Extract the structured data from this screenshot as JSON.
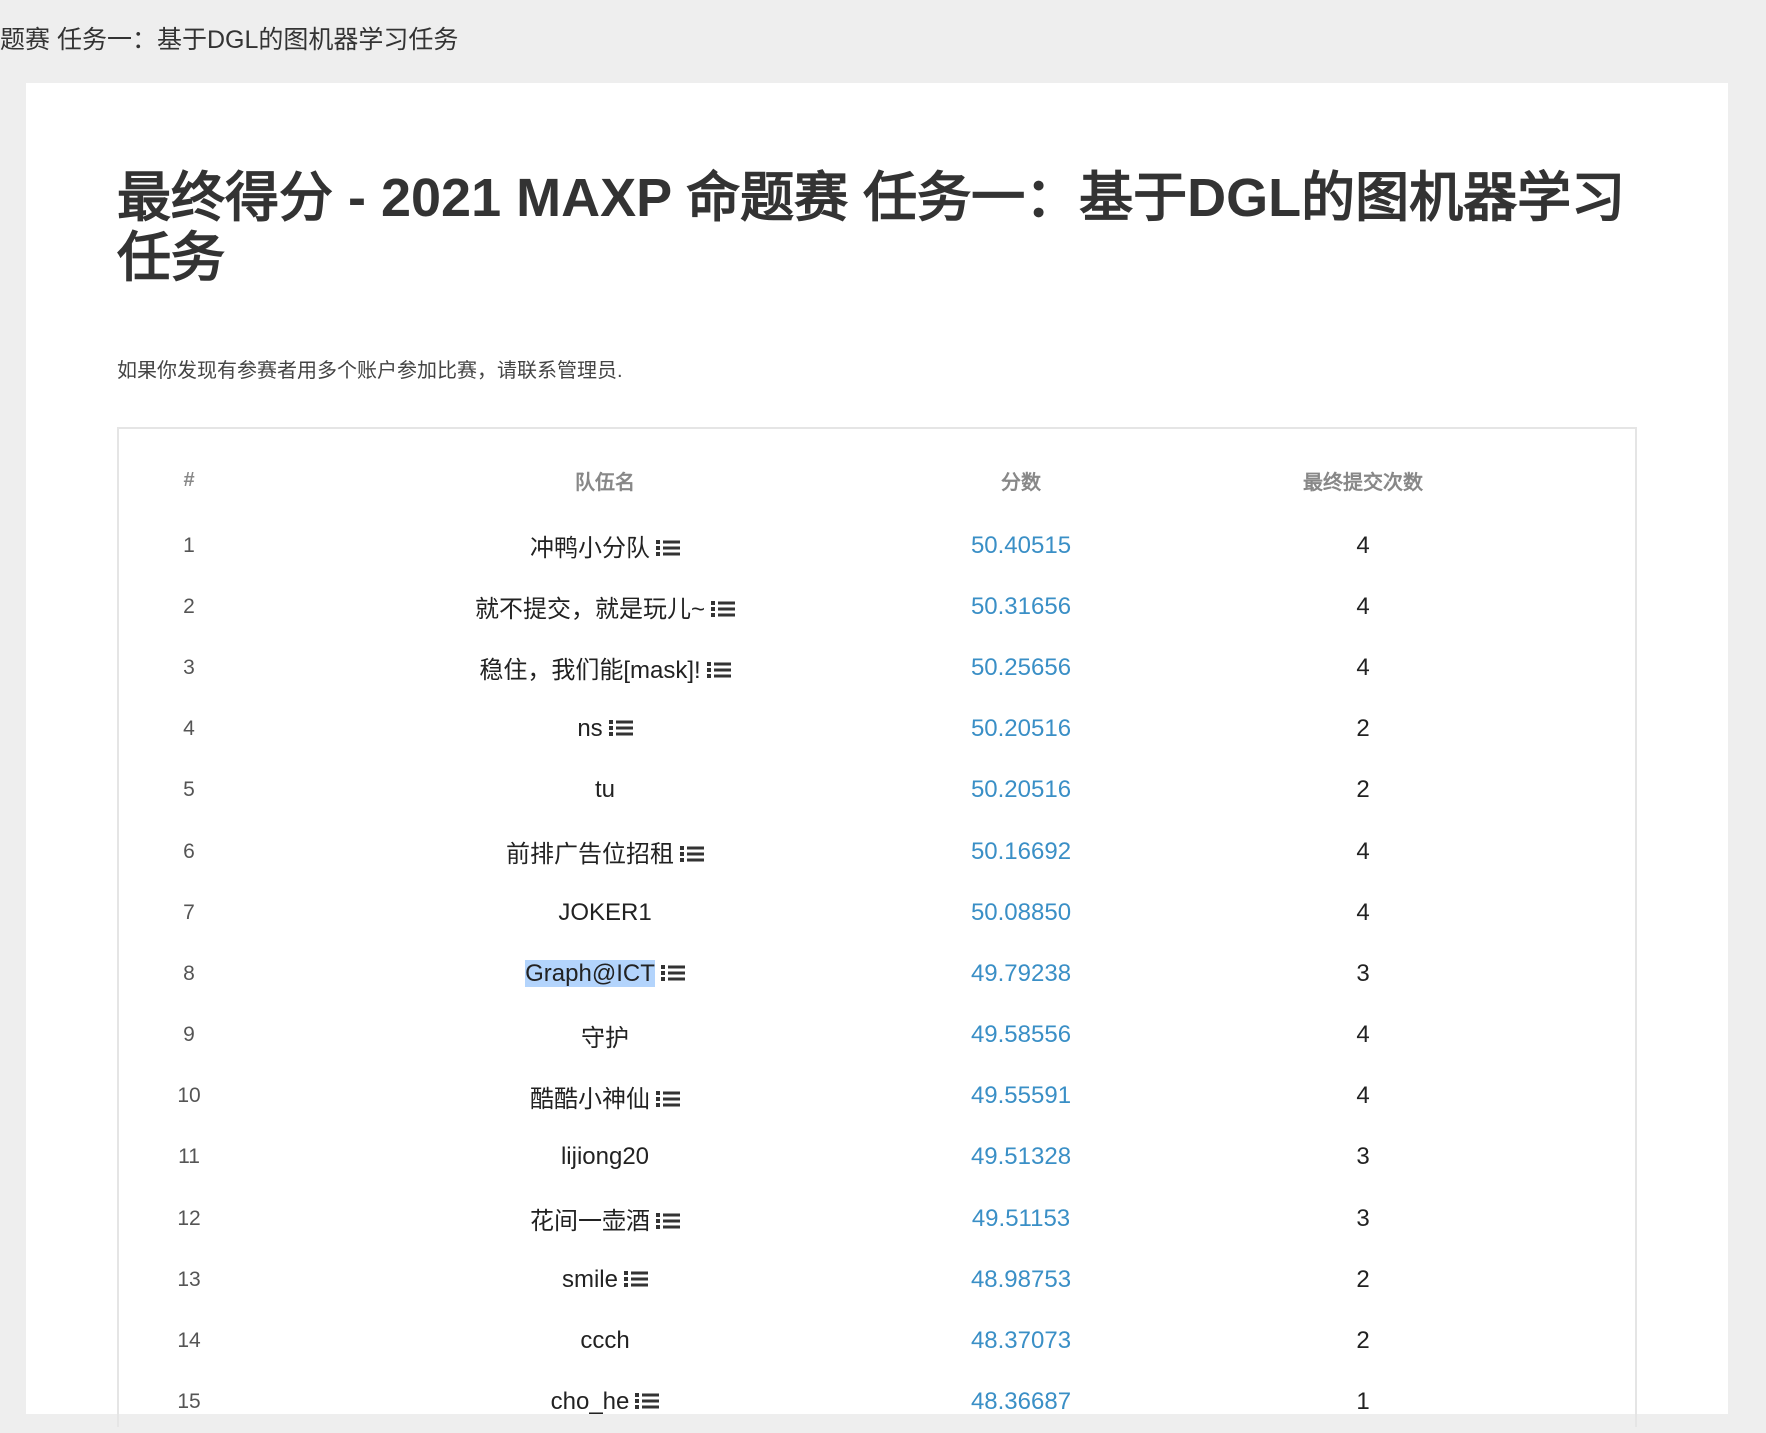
{
  "browser_tab_title": "题赛 任务一：基于DGL的图机器学习任务",
  "page_title": "最终得分 - 2021 MAXP 命题赛 任务一：基于DGL的图机器学习任务",
  "notice": "如果你发现有参赛者用多个账户参加比赛，请联系管理员.",
  "colors": {
    "score_link": "#3a8fc6",
    "selection": "#b3d4fc"
  },
  "table": {
    "headers": [
      "#",
      "队伍名",
      "分数",
      "最终提交次数"
    ],
    "rows": [
      {
        "rank": "1",
        "team": "冲鸭小分队",
        "has_list_icon": true,
        "score": "50.40515",
        "submissions": "4"
      },
      {
        "rank": "2",
        "team": "就不提交，就是玩儿~",
        "has_list_icon": true,
        "score": "50.31656",
        "submissions": "4"
      },
      {
        "rank": "3",
        "team": "稳住，我们能[mask]!",
        "has_list_icon": true,
        "score": "50.25656",
        "submissions": "4"
      },
      {
        "rank": "4",
        "team": "ns",
        "has_list_icon": true,
        "score": "50.20516",
        "submissions": "2"
      },
      {
        "rank": "5",
        "team": "tu",
        "has_list_icon": false,
        "score": "50.20516",
        "submissions": "2"
      },
      {
        "rank": "6",
        "team": "前排广告位招租",
        "has_list_icon": true,
        "score": "50.16692",
        "submissions": "4"
      },
      {
        "rank": "7",
        "team": "JOKER1",
        "has_list_icon": false,
        "score": "50.08850",
        "submissions": "4"
      },
      {
        "rank": "8",
        "team": "Graph@ICT",
        "has_list_icon": true,
        "selected": true,
        "score": "49.79238",
        "submissions": "3"
      },
      {
        "rank": "9",
        "team": "守护",
        "has_list_icon": false,
        "score": "49.58556",
        "submissions": "4"
      },
      {
        "rank": "10",
        "team": "酷酷小神仙",
        "has_list_icon": true,
        "score": "49.55591",
        "submissions": "4"
      },
      {
        "rank": "11",
        "team": "lijiong20",
        "has_list_icon": false,
        "score": "49.51328",
        "submissions": "3"
      },
      {
        "rank": "12",
        "team": "花间一壶酒",
        "has_list_icon": true,
        "score": "49.51153",
        "submissions": "3"
      },
      {
        "rank": "13",
        "team": "smile",
        "has_list_icon": true,
        "score": "48.98753",
        "submissions": "2"
      },
      {
        "rank": "14",
        "team": "ccch",
        "has_list_icon": false,
        "score": "48.37073",
        "submissions": "2"
      },
      {
        "rank": "15",
        "team": "cho_he",
        "has_list_icon": true,
        "score": "48.36687",
        "submissions": "1"
      }
    ]
  }
}
